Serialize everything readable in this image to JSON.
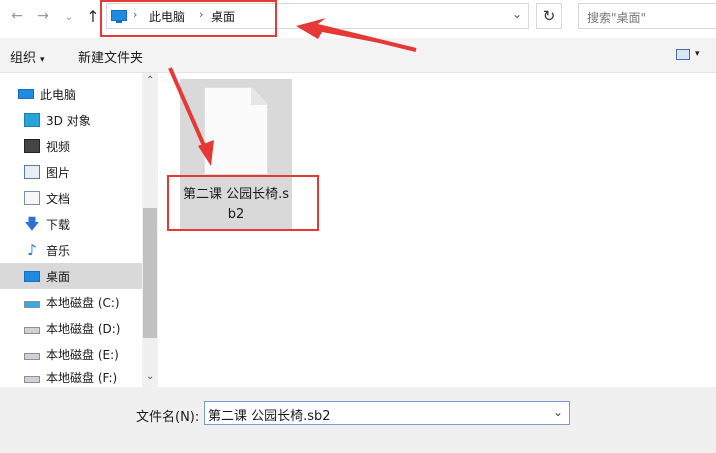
{
  "address": {
    "crumbs": [
      "此电脑",
      "桌面"
    ],
    "separator": "›"
  },
  "nav": {
    "back": "←",
    "forward": "→",
    "recent": "⌄",
    "up": "↑",
    "refresh": "↻",
    "dropdown": "⌄"
  },
  "search": {
    "placeholder": "搜索\"桌面\""
  },
  "toolbar": {
    "organize": "组织",
    "organize_caret": "▾",
    "new_folder": "新建文件夹",
    "view_caret": "▾"
  },
  "sidebar": {
    "items": [
      {
        "label": "此电脑",
        "icon": "computer-icon"
      },
      {
        "label": "3D 对象",
        "icon": "3d-objects-icon"
      },
      {
        "label": "视频",
        "icon": "video-icon"
      },
      {
        "label": "图片",
        "icon": "pictures-icon"
      },
      {
        "label": "文档",
        "icon": "documents-icon"
      },
      {
        "label": "下载",
        "icon": "download-icon",
        "glyph": "🡇"
      },
      {
        "label": "音乐",
        "icon": "music-icon",
        "glyph": "♪"
      },
      {
        "label": "桌面",
        "icon": "desktop-icon",
        "selected": true
      },
      {
        "label": "本地磁盘 (C:)",
        "icon": "drive-icon"
      },
      {
        "label": "本地磁盘 (D:)",
        "icon": "drive-icon"
      },
      {
        "label": "本地磁盘 (E:)",
        "icon": "drive-icon"
      },
      {
        "label": "本地磁盘 (F:)",
        "icon": "drive-icon"
      }
    ],
    "scroll_up": "⌃",
    "scroll_down": "⌄"
  },
  "content": {
    "file": {
      "name": "第二课 公园长椅.sb2",
      "icon": "blank-file-icon"
    }
  },
  "footer": {
    "filename_label": "文件名(N):",
    "filename_value": "第二课 公园长椅.sb2",
    "dropdown": "⌄"
  },
  "colors": {
    "annotation_red": "#e53935",
    "selection": "#d9d9d9",
    "accent_blue": "#1f8be0"
  }
}
